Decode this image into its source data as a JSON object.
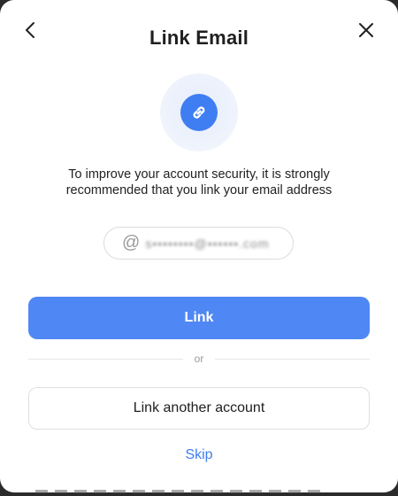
{
  "dialog": {
    "title": "Link Email",
    "description": "To improve your account security, it is strongly recommended that you link your email address",
    "email_prefix": "@",
    "email_value": "s••••••••@••••••.com",
    "primary_label": "Link",
    "divider_label": "or",
    "secondary_label": "Link another account",
    "skip_label": "Skip"
  },
  "icons": {
    "back": "chevron-left-icon",
    "close": "close-icon",
    "hero": "link-icon"
  },
  "colors": {
    "accent": "#4f87f5",
    "link": "#3f7ef2",
    "title": "#1f1f1f"
  }
}
